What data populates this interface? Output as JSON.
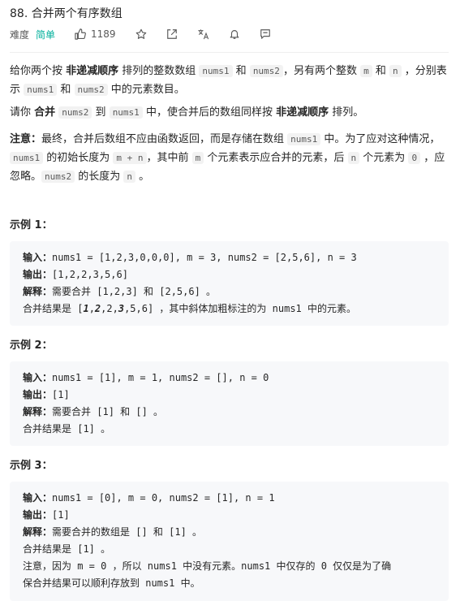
{
  "header": {
    "title": "88. 合并两个有序数组",
    "difficulty_label": "难度",
    "difficulty_value": "简单",
    "likes": "1189"
  },
  "description": {
    "p1": [
      "给你两个按 ",
      "非递减顺序",
      " 排列的整数数组 ",
      "nums1",
      " 和 ",
      "nums2",
      "，另有两个整数 ",
      "m",
      " 和 ",
      "n",
      " ，分别表示 ",
      "nums1",
      " 和 ",
      "nums2",
      " 中的元素数目。"
    ],
    "p2": [
      "请你 ",
      "合并",
      " ",
      "nums2",
      " 到 ",
      "nums1",
      " 中，使合并后的数组同样按 ",
      "非递减顺序",
      " 排列。"
    ],
    "p3": [
      "注意：",
      "最终，合并后数组不应由函数返回，而是存储在数组 ",
      "nums1",
      " 中。为了应对这种情况，",
      "nums1",
      " 的初始长度为 ",
      "m + n",
      "，其中前 ",
      "m",
      " 个元素表示应合并的元素，后 ",
      "n",
      " 个元素为 ",
      "0",
      " ，应忽略。",
      "nums2",
      " 的长度为 ",
      "n",
      " 。"
    ]
  },
  "examples": [
    {
      "heading": "示例 1：",
      "input_label": "输入：",
      "input": "nums1 = [1,2,3,0,0,0], m = 3, nums2 = [2,5,6], n = 3",
      "output_label": "输出：",
      "output": "[1,2,2,3,5,6]",
      "expl_label": "解释：",
      "expl": "需要合并 [1,2,3] 和 [2,5,6] 。",
      "line4_a": "合并结果是 [",
      "line4_b1": "1",
      "line4_c1": ",",
      "line4_b2": "2",
      "line4_c2": ",2,",
      "line4_b3": "3",
      "line4_c3": ",5,6] ，其中斜体加粗标注的为 nums1 中的元素。"
    },
    {
      "heading": "示例 2：",
      "input_label": "输入：",
      "input": "nums1 = [1], m = 1, nums2 = [], n = 0",
      "output_label": "输出：",
      "output": "[1]",
      "expl_label": "解释：",
      "expl": "需要合并 [1] 和 [] 。",
      "line4": "合并结果是 [1] 。"
    },
    {
      "heading": "示例 3：",
      "input_label": "输入：",
      "input": "nums1 = [0], m = 0, nums2 = [1], n = 1",
      "output_label": "输出：",
      "output": "[1]",
      "expl_label": "解释：",
      "expl": "需要合并的数组是 [] 和 [1] 。",
      "line4": "合并结果是 [1] 。",
      "line5": "注意，因为 m = 0 ，所以 nums1 中没有元素。nums1 中仅存的 0 仅仅是为了确",
      "line6": "保合并结果可以顺利存放到 nums1 中。"
    }
  ]
}
